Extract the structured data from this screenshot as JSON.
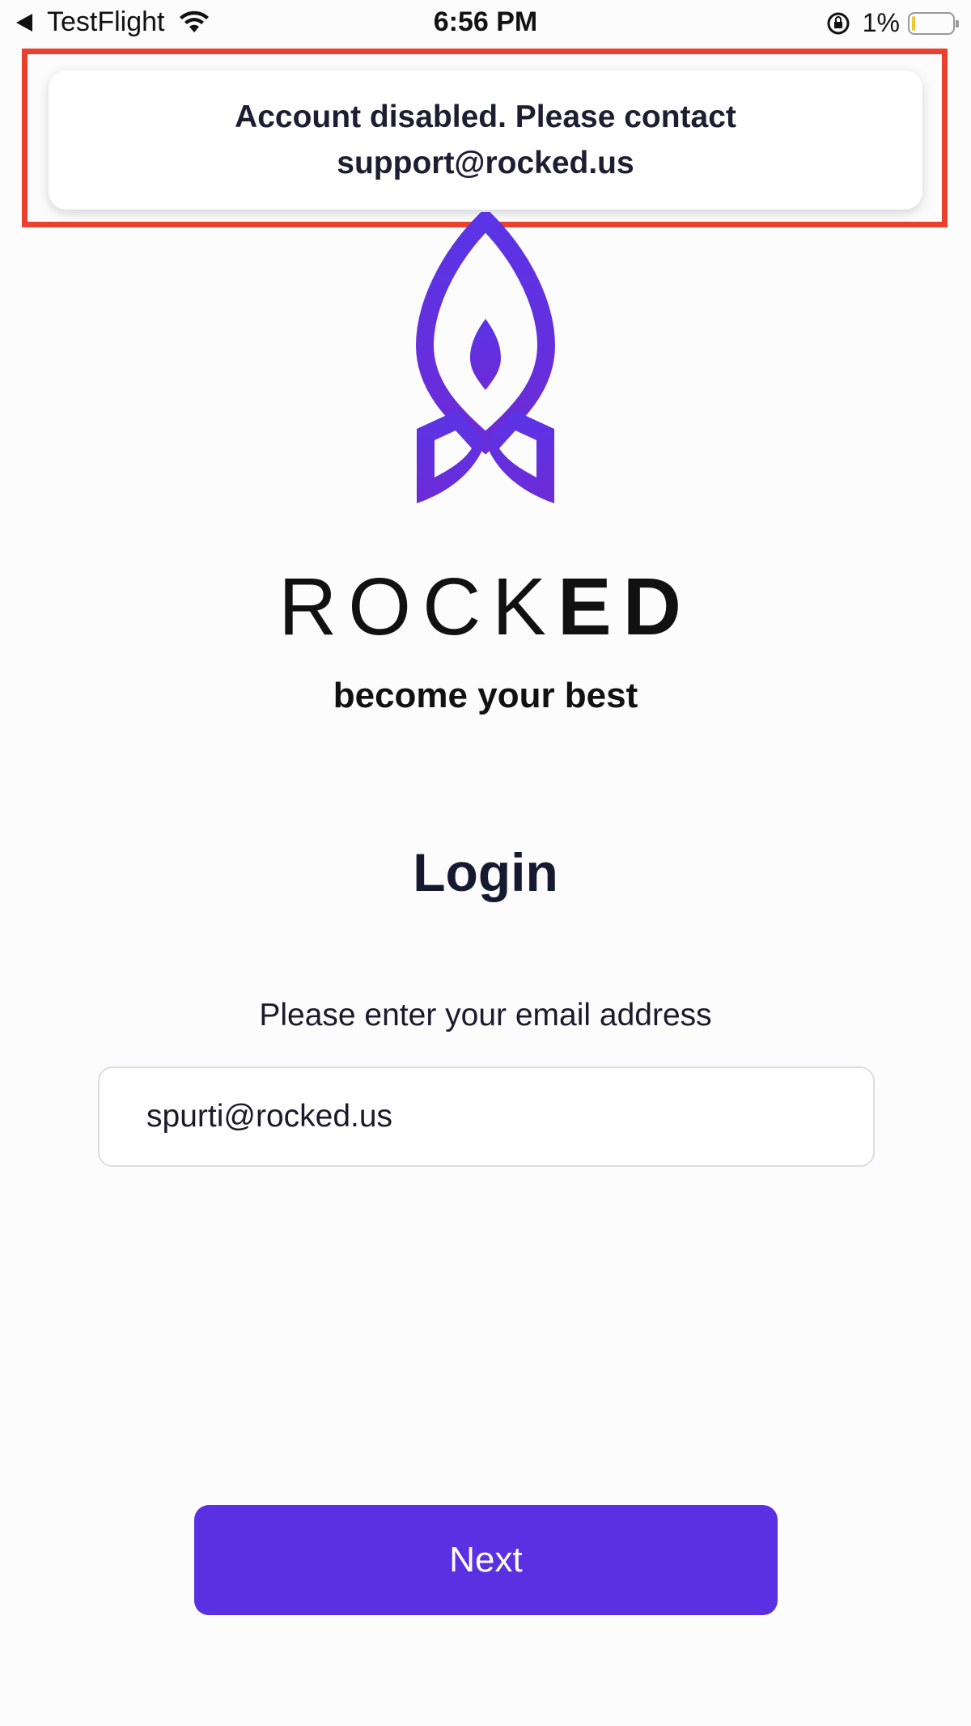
{
  "status_bar": {
    "back_app": "TestFlight",
    "time": "6:56 PM",
    "battery": "1%"
  },
  "toast": {
    "message": "Account disabled. Please contact support@rocked.us"
  },
  "brand": {
    "name_light": "ROCK",
    "name_bold": "ED",
    "tagline": "become your best"
  },
  "login": {
    "title": "Login",
    "prompt": "Please enter your email address",
    "email_value": "spurti@rocked.us",
    "next_label": "Next"
  },
  "colors": {
    "accent": "#5b30e3",
    "highlight": "#e9412d"
  }
}
